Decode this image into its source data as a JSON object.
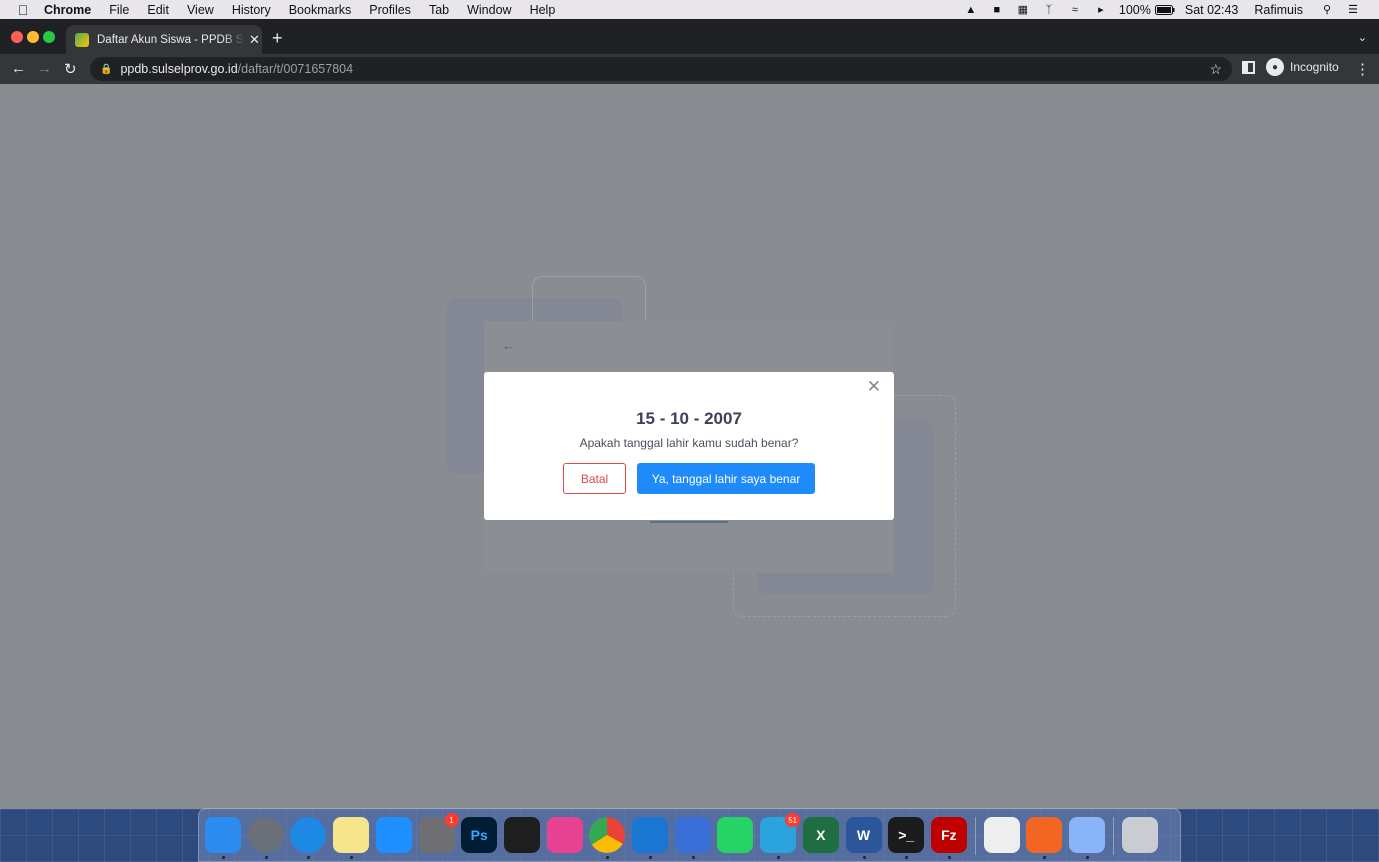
{
  "menubar": {
    "app_name": "Chrome",
    "items": [
      "File",
      "Edit",
      "View",
      "History",
      "Bookmarks",
      "Profiles",
      "Tab",
      "Window",
      "Help"
    ],
    "battery": "100%",
    "clock": "Sat 02:43",
    "user": "Rafimuis"
  },
  "browser": {
    "tab_title": "Daftar Akun Siswa - PPDB Sulsel",
    "url_host": "ppdb.sulselprov.go.id",
    "url_path": "/daftar/t/0071657804",
    "profile_label": "Incognito"
  },
  "modal": {
    "date": "15 - 10 - 2007",
    "question": "Apakah tanggal lahir kamu sudah benar?",
    "cancel_label": "Batal",
    "confirm_label": "Ya, tanggal lahir saya benar"
  },
  "dock": {
    "apps": [
      {
        "name": "finder-icon",
        "color": "#2d8cf0"
      },
      {
        "name": "launchpad-icon",
        "color": "#6b6f7a"
      },
      {
        "name": "safari-icon",
        "color": "#1e88e5"
      },
      {
        "name": "notes-icon",
        "color": "#f6e58d"
      },
      {
        "name": "app-store-icon",
        "color": "#1e90ff"
      },
      {
        "name": "system-preferences-icon",
        "color": "#6e6e73",
        "badge": "1"
      },
      {
        "name": "photoshop-icon",
        "color": "#001d34",
        "glyph": "Ps"
      },
      {
        "name": "figma-icon",
        "color": "#1e1e1e"
      },
      {
        "name": "cleanmymac-icon",
        "color": "#e84393"
      },
      {
        "name": "chrome-icon",
        "color": "#ffffff"
      },
      {
        "name": "vscode-icon",
        "color": "#1976d2"
      },
      {
        "name": "kite-icon",
        "color": "#3a6fd8"
      },
      {
        "name": "whatsapp-icon",
        "color": "#25d366"
      },
      {
        "name": "telegram-icon",
        "color": "#2aa3de",
        "badge": "51"
      },
      {
        "name": "excel-icon",
        "color": "#1d6f42",
        "glyph": "X"
      },
      {
        "name": "word-icon",
        "color": "#2b579a",
        "glyph": "W"
      },
      {
        "name": "terminal-icon",
        "color": "#1b1b1b",
        "glyph": ">_"
      },
      {
        "name": "filezilla-icon",
        "color": "#bf0000",
        "glyph": "Fz"
      },
      {
        "name": "textedit-icon",
        "color": "#eeeeee"
      },
      {
        "name": "pencil-app-icon",
        "color": "#f26522"
      },
      {
        "name": "preview-icon",
        "color": "#8ab4f8"
      },
      {
        "name": "trash-icon",
        "color": "#c9ccd1"
      }
    ]
  }
}
